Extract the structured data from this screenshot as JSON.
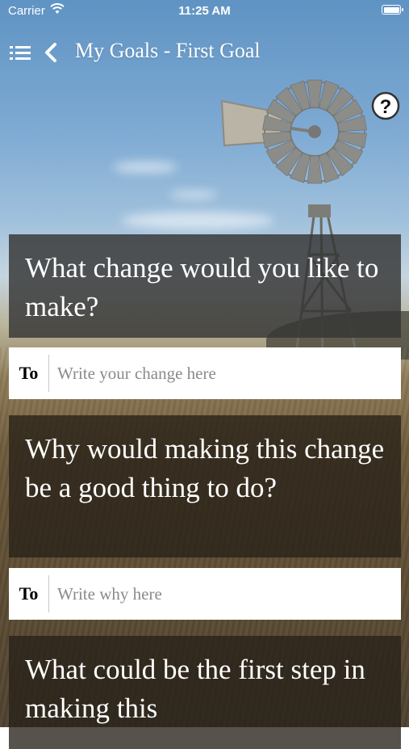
{
  "status_bar": {
    "carrier": "Carrier",
    "time": "11:25 AM",
    "battery_level": 1.0
  },
  "nav": {
    "menu_icon": "list-icon",
    "back_icon": "chevron-left-icon",
    "title": "My Goals - First Goal",
    "help_icon": "question-circle-icon"
  },
  "questions": [
    {
      "text": "What change would you like to make?",
      "answer_prefix": "To",
      "answer_placeholder": "Write your change here",
      "answer_value": ""
    },
    {
      "text": "Why would making this change be a good thing to do?",
      "answer_prefix": "To",
      "answer_placeholder": "Write why here",
      "answer_value": ""
    },
    {
      "text": "What could be the first step in making this"
    }
  ],
  "colors": {
    "sky_top": "#5f93c3",
    "card_dark": "#343434",
    "card_brown": "#282118",
    "answer_bg": "#ffffff",
    "placeholder": "#8a8a8a"
  }
}
